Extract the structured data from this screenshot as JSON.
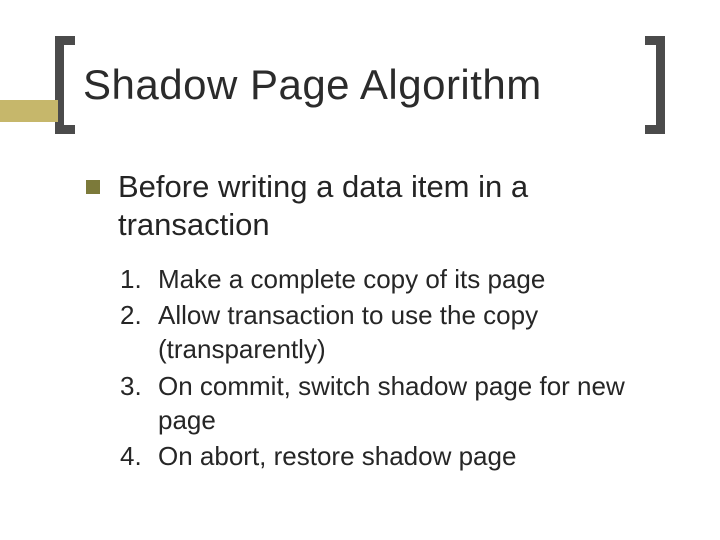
{
  "title": "Shadow Page Algorithm",
  "bullet": "Before writing a data item in a transaction",
  "list": {
    "items": [
      {
        "n": "1.",
        "t": "Make a complete copy of its page"
      },
      {
        "n": "2.",
        "t": "Allow transaction to use the copy (transparently)"
      },
      {
        "n": "3.",
        "t": "On commit, switch shadow page for new page"
      },
      {
        "n": "4.",
        "t": "On abort, restore shadow page"
      }
    ]
  }
}
